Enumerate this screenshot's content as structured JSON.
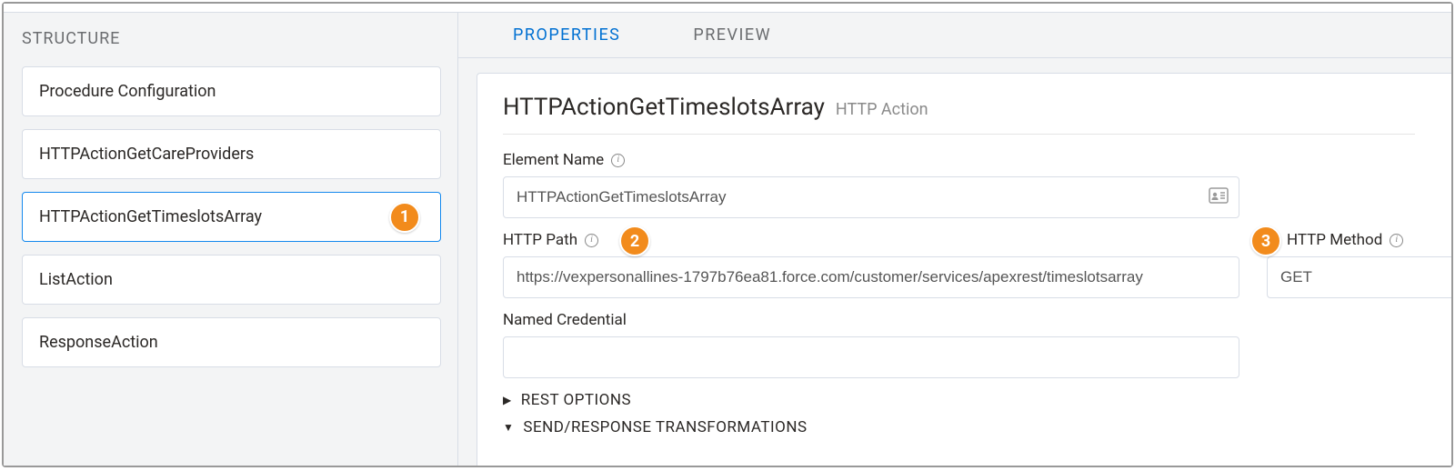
{
  "sidebar": {
    "header": "STRUCTURE",
    "items": [
      {
        "label": "Procedure Configuration"
      },
      {
        "label": "HTTPActionGetCareProviders"
      },
      {
        "label": "HTTPActionGetTimeslotsArray"
      },
      {
        "label": "ListAction"
      },
      {
        "label": "ResponseAction"
      }
    ]
  },
  "tabs": {
    "properties": "PROPERTIES",
    "preview": "PREVIEW"
  },
  "panel": {
    "title": "HTTPActionGetTimeslotsArray",
    "subtitle": "HTTP Action"
  },
  "form": {
    "element_name_label": "Element Name",
    "element_name_value": "HTTPActionGetTimeslotsArray",
    "http_path_label": "HTTP Path",
    "http_path_value": "https://vexpersonallines-1797b76ea81.force.com/customer/services/apexrest/timeslotsarray",
    "http_method_label": "HTTP Method",
    "http_method_value": "GET",
    "named_credential_label": "Named Credential",
    "named_credential_value": ""
  },
  "sections": {
    "rest_options": "REST OPTIONS",
    "send_response": "SEND/RESPONSE TRANSFORMATIONS"
  },
  "callouts": {
    "one": "1",
    "two": "2",
    "three": "3"
  }
}
